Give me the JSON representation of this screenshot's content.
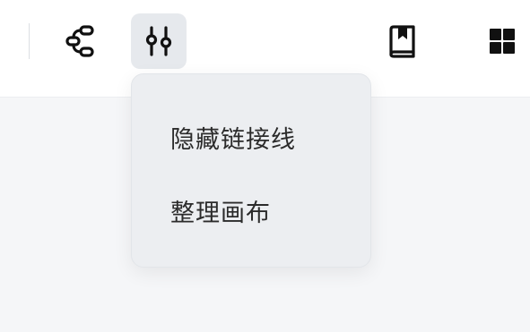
{
  "toolbar": {
    "buttons": [
      {
        "icon": "flow-connector-icon"
      },
      {
        "icon": "sliders-icon",
        "active": true
      },
      {
        "icon": "book-icon"
      },
      {
        "icon": "grid-icon"
      }
    ]
  },
  "menu": {
    "items": [
      {
        "label": "隐藏链接线"
      },
      {
        "label": "整理画布"
      }
    ]
  },
  "colors": {
    "icon": "#111111",
    "active_bg": "#e6e9ed",
    "menu_bg": "#eceef1",
    "canvas_bg": "#f5f6f8"
  }
}
